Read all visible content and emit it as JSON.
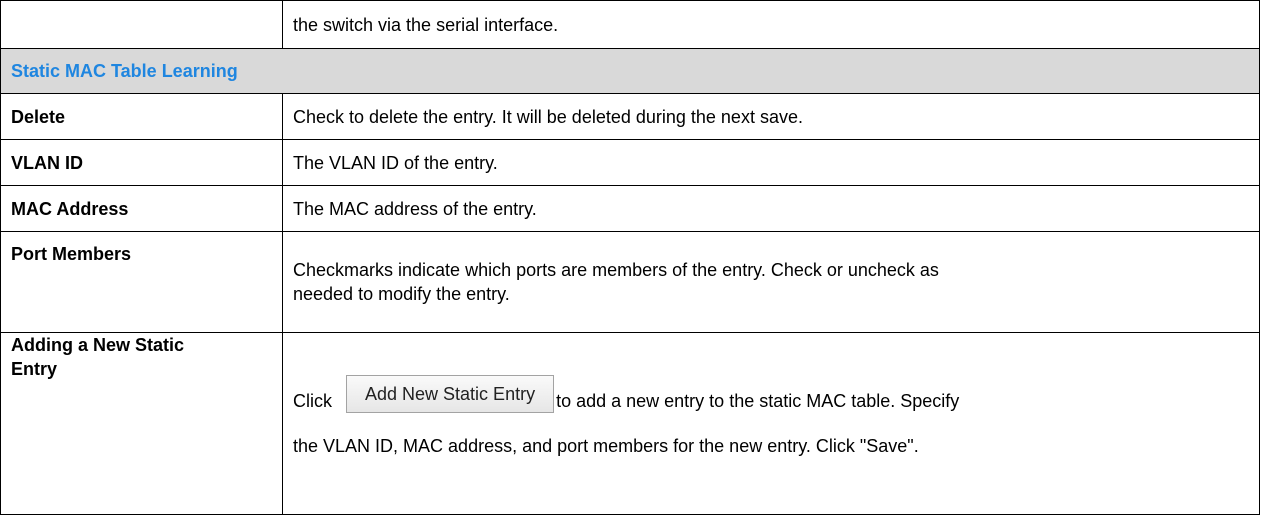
{
  "rows": {
    "continuation": {
      "description": "the switch via the serial interface."
    },
    "section_header": "Static MAC Table Learning",
    "delete": {
      "term": "Delete",
      "description": "Check to delete the entry. It will be deleted during the next save."
    },
    "vlan_id": {
      "term": "VLAN ID",
      "description": "The VLAN ID of the entry."
    },
    "mac_address": {
      "term": "MAC Address",
      "description": "The MAC address of the entry."
    },
    "port_members": {
      "term": "Port Members",
      "description_line1": "Checkmarks indicate which ports are members of the entry. Check or uncheck as",
      "description_line2": "needed to modify the entry."
    },
    "adding_entry": {
      "term_line1": "Adding a New Static",
      "term_line2": "Entry",
      "click_label": "Click",
      "button_label": "Add New Static Entry",
      "description_line1": "to add a new entry to the static MAC table. Specify",
      "description_line2": "the VLAN ID, MAC address, and port members for the new entry. Click \"Save\"."
    }
  },
  "colors": {
    "section_text": "#1f86e0",
    "section_background": "#d9d9d9",
    "border": "#000000"
  }
}
